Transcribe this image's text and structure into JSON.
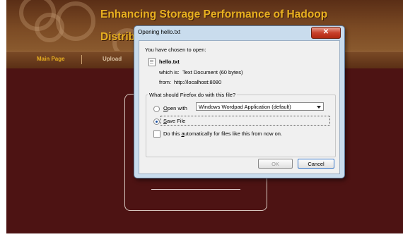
{
  "site": {
    "title_line1": "Enhancing Storage Performance of Hadoop",
    "title_line2": "Distrib",
    "nav": [
      {
        "label": "Main Page",
        "color": "#e8b020"
      },
      {
        "label": "Upload",
        "color": "#d8c0a0"
      }
    ]
  },
  "dialog": {
    "title": "Opening hello.txt",
    "close_label": "✕",
    "intro": "You have chosen to open:",
    "filename": "hello.txt",
    "which_is_label": "which is:",
    "which_is_value": "Text Document (60 bytes)",
    "from_label": "from:",
    "from_value": "http://localhost:8080",
    "question": "What should Firefox do with this file?",
    "open_with_prefix": "O",
    "open_with_rest": "pen with",
    "open_with_app": "Windows Wordpad Application (default)",
    "save_prefix": "S",
    "save_rest": "ave File",
    "auto_text_a": "Do this ",
    "auto_text_u": "a",
    "auto_text_b": "utomatically for files like this from now on.",
    "ok_label": "OK",
    "cancel_label": "Cancel",
    "selected_option": "Save File",
    "auto_checked": false
  }
}
